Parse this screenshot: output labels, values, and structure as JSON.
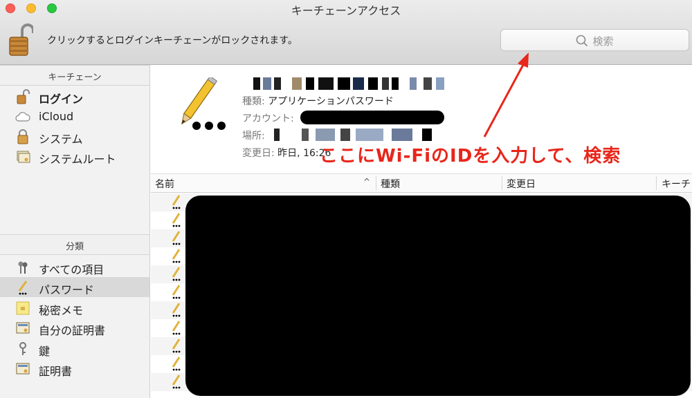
{
  "window": {
    "title": "キーチェーンアクセス"
  },
  "toolbar": {
    "lock_message": "クリックするとログインキーチェーンがロックされます。",
    "search_placeholder": "検索"
  },
  "sidebar": {
    "keychains_header": "キーチェーン",
    "keychains": [
      {
        "label": "ログイン",
        "icon": "unlocked-padlock-icon"
      },
      {
        "label": "iCloud",
        "icon": "cloud-icon"
      },
      {
        "label": "システム",
        "icon": "padlock-icon"
      },
      {
        "label": "システムルート",
        "icon": "certificate-folder-icon"
      }
    ],
    "category_header": "分類",
    "categories": [
      {
        "label": "すべての項目",
        "icon": "keys-icon"
      },
      {
        "label": "パスワード",
        "icon": "pencil-icon"
      },
      {
        "label": "秘密メモ",
        "icon": "note-icon"
      },
      {
        "label": "自分の証明書",
        "icon": "my-certificate-icon"
      },
      {
        "label": "鍵",
        "icon": "key-icon"
      },
      {
        "label": "証明書",
        "icon": "certificate-icon"
      }
    ]
  },
  "detail": {
    "kind_label": "種類:",
    "kind_value": "アプリケーションパスワード",
    "account_label": "アカウント:",
    "location_label": "場所:",
    "modified_label": "変更日:",
    "modified_value": "昨日, 16:26"
  },
  "annotation": {
    "text": "ここにWi-FiのIDを入力して、検索",
    "color": "#e8261a"
  },
  "table": {
    "columns": [
      "名前",
      "種類",
      "変更日",
      "キーチ"
    ],
    "sort_indicator": "^",
    "row_count": 11
  },
  "colors": {
    "selected_row": "#d9d9d9",
    "annotation_red": "#e8261a"
  }
}
